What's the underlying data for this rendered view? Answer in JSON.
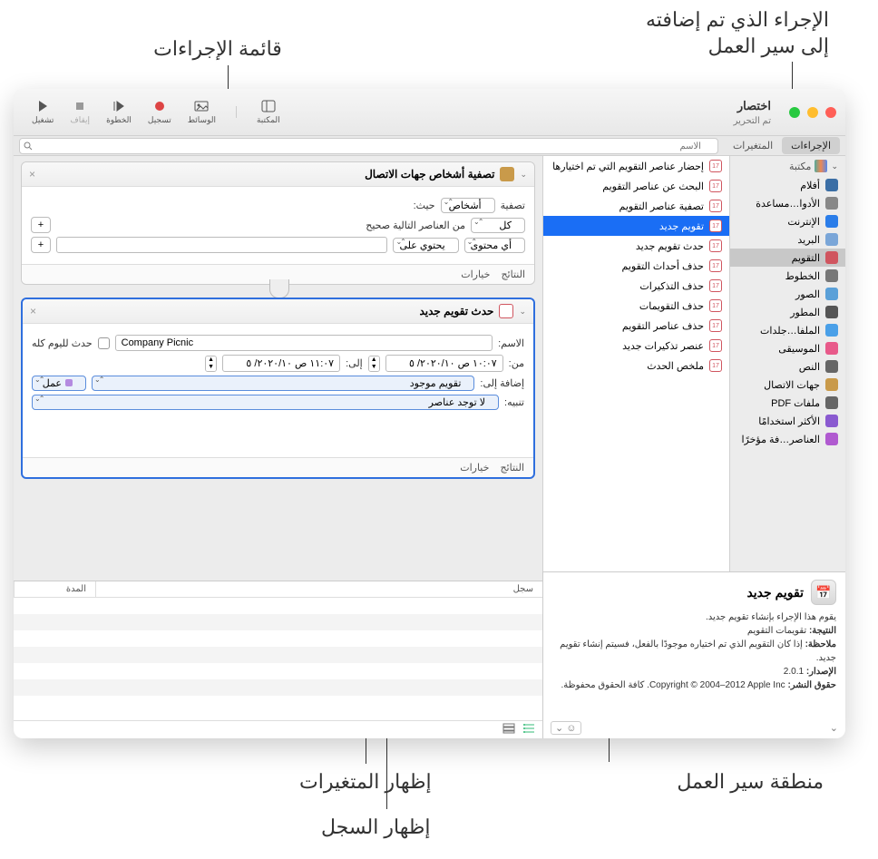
{
  "annotations": {
    "added_action": "الإجراء الذي تم إضافته\nإلى سير العمل",
    "actions_list": "قائمة الإجراءات",
    "workflow_area": "منطقة سير العمل",
    "show_vars": "إظهار المتغيرات",
    "show_log": "إظهار السجل"
  },
  "window": {
    "title": "اختصار",
    "subtitle": "تم التحرير"
  },
  "toolbar": {
    "library": "المكتبة",
    "media": "الوسائط",
    "record": "تسجيل",
    "step": "الخطوة",
    "stop": "إيقاف",
    "run": "تشغيل"
  },
  "tabs": {
    "actions": "الإجراءات",
    "variables": "المتغيرات"
  },
  "search": {
    "placeholder": "الاسم"
  },
  "library": {
    "header": "مكتبة",
    "items": [
      {
        "label": "أفلام",
        "color": "#3b6ea5"
      },
      {
        "label": "الأدوا…مساعدة",
        "color": "#888"
      },
      {
        "label": "الإنترنت",
        "color": "#2b7de9"
      },
      {
        "label": "البريد",
        "color": "#7aa6d8"
      },
      {
        "label": "التقويم",
        "color": "#d0555f"
      },
      {
        "label": "الخطوط",
        "color": "#777"
      },
      {
        "label": "الصور",
        "color": "#5aa0d8"
      },
      {
        "label": "المطور",
        "color": "#555"
      },
      {
        "label": "الملفا…جلدات",
        "color": "#4aa0e8"
      },
      {
        "label": "الموسيقى",
        "color": "#e85a8a"
      },
      {
        "label": "النص",
        "color": "#666"
      },
      {
        "label": "جهات الاتصال",
        "color": "#c99a4a"
      },
      {
        "label": "ملفات PDF",
        "color": "#666"
      },
      {
        "label": "الأكثر استخدامًا",
        "color": "#8a5ad0"
      },
      {
        "label": "العناصر…فة مؤخرًا",
        "color": "#b05ad0"
      }
    ]
  },
  "actions": [
    "إحضار عناصر التقويم التي تم اختيارها",
    "البحث عن عناصر التقويم",
    "تصفية عناصر التقويم",
    "تقويم جديد",
    "حدث تقويم جديد",
    "حذف أحداث التقويم",
    "حذف التذكيرات",
    "حذف التقويمات",
    "حذف عناصر التقويم",
    "عنصر تذكيرات جديد",
    "ملخص الحدث"
  ],
  "card1": {
    "title": "تصفية أشخاص جهات الاتصال",
    "filter_label": "تصفية",
    "filter_value": "أشخاص",
    "where": "حيث:",
    "all": "كل",
    "following_true": "من العناصر التالية صحيح",
    "any_content": "أي محتوى",
    "contains": "يحتوي على",
    "options": "خيارات",
    "results": "النتائج"
  },
  "card2": {
    "title": "حدث تقويم جديد",
    "name_label": "الاسم:",
    "name_value": "Company Picnic",
    "allday": "حدث لليوم كله",
    "from_label": "من:",
    "from_value": "١٠:٠٧ ص ٢٠٢٠/١٠/ ٥",
    "to_label": "إلى:",
    "to_value": "١١:٠٧ ص ٢٠٢٠/١٠/ ٥",
    "addto_label": "إضافة إلى:",
    "addto_value": "تقويم موجود",
    "work": "عمل",
    "alert_label": "تنبيه:",
    "alert_value": "لا توجد عناصر",
    "options": "خيارات",
    "results": "النتائج"
  },
  "log": {
    "col_log": "سجل",
    "col_duration": "المدة"
  },
  "info": {
    "title": "تقويم جديد",
    "desc": "يقوم هذا الإجراء بإنشاء تقويم جديد.",
    "result_label": "النتيجة:",
    "result_value": "تقويمات التقويم",
    "note_label": "ملاحظة:",
    "note_value": "إذا كان التقويم الذي تم اختياره موجودًا بالفعل، فسيتم إنشاء تقويم جديد.",
    "version_label": "الإصدار:",
    "version_value": "2.0.1",
    "copyright_label": "حقوق النشر:",
    "copyright_value": "Copyright © 2004–2012 Apple Inc. كافة الحقوق محفوظة."
  }
}
